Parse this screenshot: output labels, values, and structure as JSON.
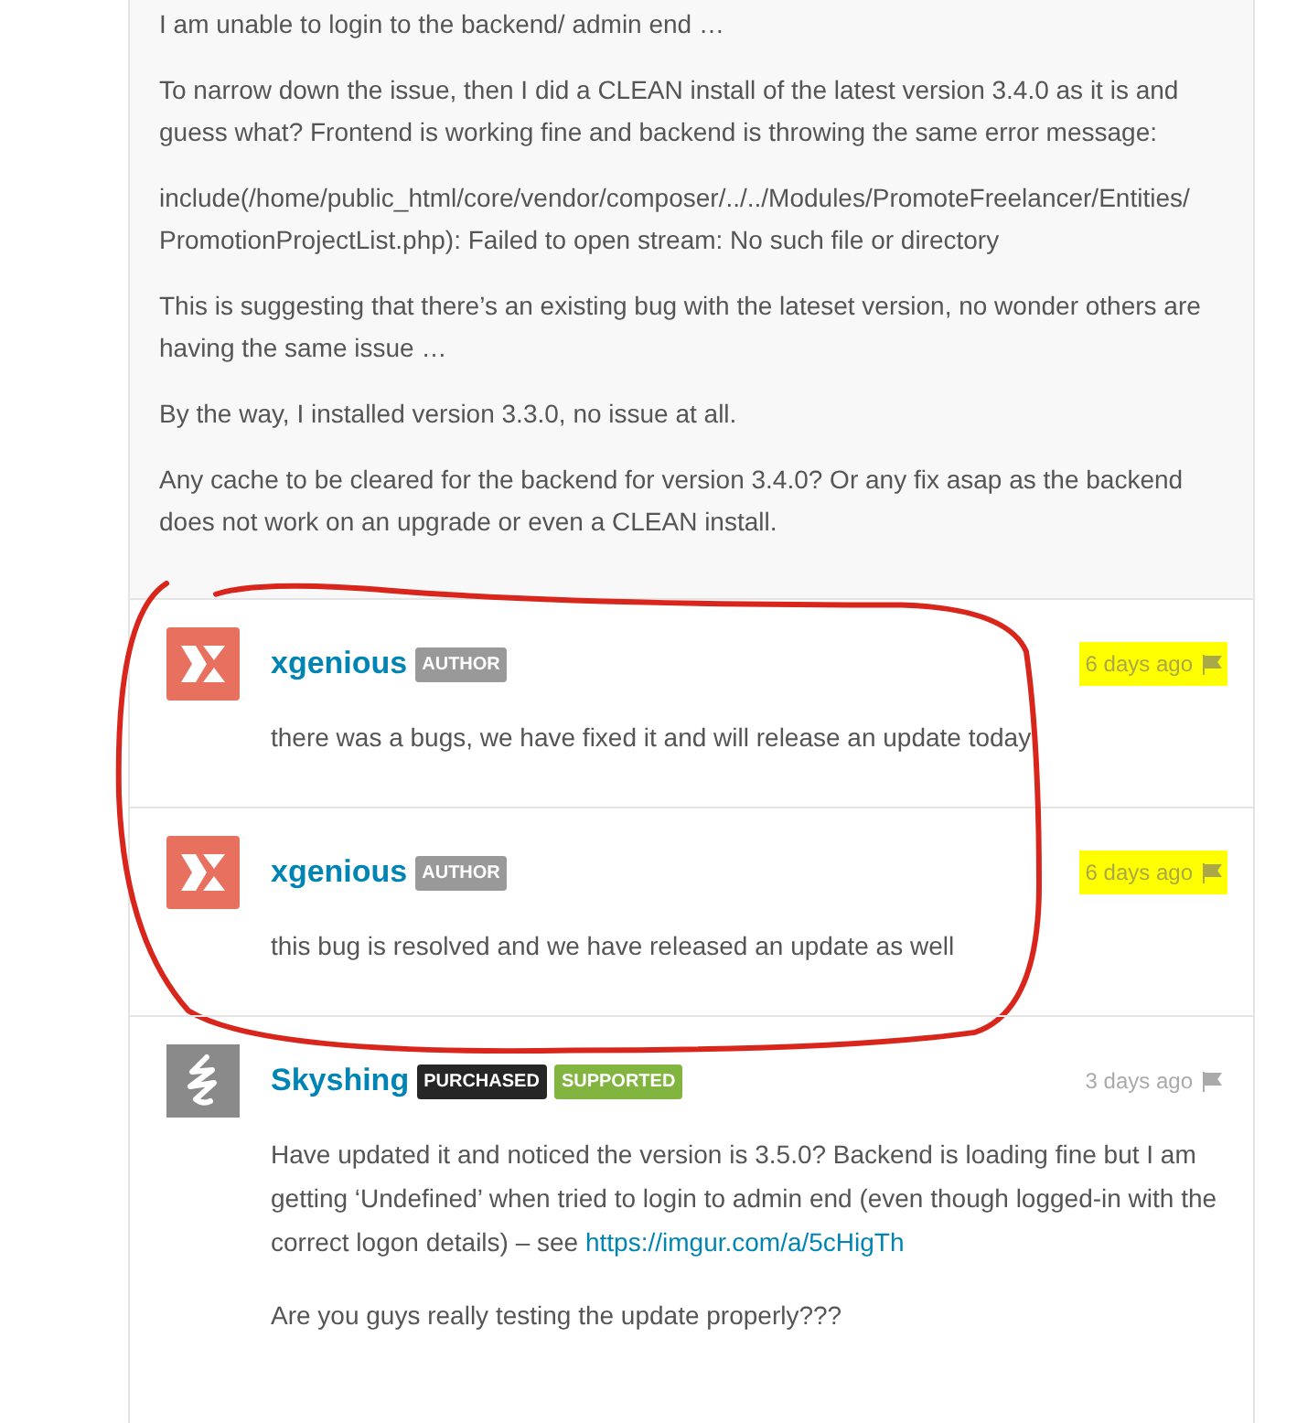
{
  "post": {
    "paragraphs": [
      "I am unable to login to the backend/ admin end …",
      "To narrow down the issue, then I did a CLEAN install of the latest version 3.4.0 as it is and guess what? Frontend is working fine and backend is throwing the same error message:",
      "include(/home/public_html/core/vendor/composer/../../Modules/PromoteFreelancer/Entities/ PromotionProjectList.php): Failed to open stream: No such file or directory",
      "This is suggesting that there’s an existing bug with the lateset version, no wonder others are having the same issue …",
      "By the way, I installed version 3.3.0, no issue at all.",
      "Any cache to be cleared for the backend for version 3.4.0? Or any fix asap as the backend does not work on an upgrade or even a CLEAN install."
    ]
  },
  "comments": [
    {
      "author": "xgenious",
      "kind": "logo",
      "badges": [
        {
          "label": "AUTHOR",
          "color": "#999999"
        }
      ],
      "time": "6 days ago",
      "highlighted": true,
      "circled": true,
      "paragraphs": [
        [
          {
            "kind": "text",
            "text": "there was a bugs, we have fixed it and will release an update today"
          }
        ]
      ]
    },
    {
      "author": "xgenious",
      "kind": "logo",
      "badges": [
        {
          "label": "AUTHOR",
          "color": "#999999"
        }
      ],
      "time": "6 days ago",
      "highlighted": true,
      "circled": true,
      "paragraphs": [
        [
          {
            "kind": "text",
            "text": "this bug is resolved and we have released an update as well"
          }
        ]
      ]
    },
    {
      "author": "Skyshing",
      "kind": "squiggle",
      "badges": [
        {
          "label": "PURCHASED",
          "color": "#262626"
        },
        {
          "label": "SUPPORTED",
          "color": "#82b440"
        }
      ],
      "time": "3 days ago",
      "highlighted": false,
      "circled": false,
      "paragraphs": [
        [
          {
            "kind": "text",
            "text": "Have updated it and noticed the version is 3.5.0? Backend is loading fine but I am getting ‘Undefined’ when tried to login to admin end (even though logged-in with the correct logon details) – see "
          },
          {
            "kind": "link",
            "text": "https://imgur.com/a/5cHigTh"
          }
        ],
        [
          {
            "kind": "text",
            "text": "Are you guys really testing the update properly???"
          }
        ]
      ]
    }
  ]
}
